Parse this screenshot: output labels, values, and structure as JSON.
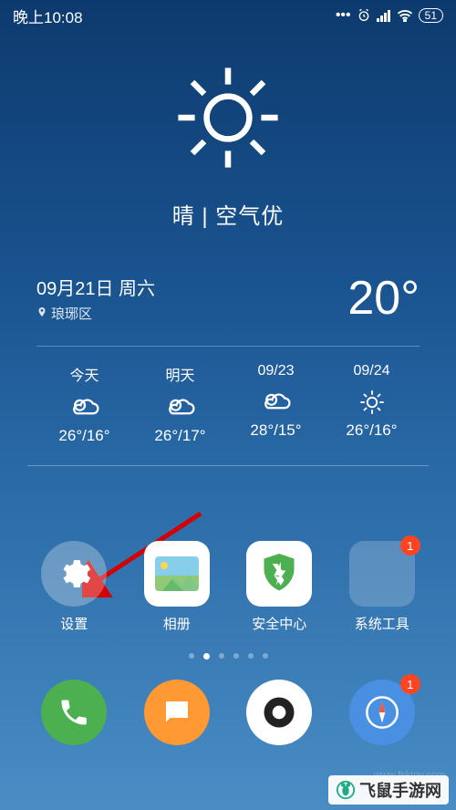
{
  "status": {
    "time": "晚上10:08",
    "battery": "51"
  },
  "weather": {
    "condition": "晴 | 空气优",
    "date": "09月21日 周六",
    "location": "琅琊区",
    "temp": "20°"
  },
  "forecast": [
    {
      "day": "今天",
      "icon": "cloudy",
      "temp": "26°/16°"
    },
    {
      "day": "明天",
      "icon": "cloudy",
      "temp": "26°/17°"
    },
    {
      "day": "09/23",
      "icon": "cloudy",
      "temp": "28°/15°"
    },
    {
      "day": "09/24",
      "icon": "sunny",
      "temp": "26°/16°"
    }
  ],
  "apps": {
    "settings": {
      "label": "设置"
    },
    "gallery": {
      "label": "相册"
    },
    "security": {
      "label": "安全中心"
    },
    "tools": {
      "label": "系统工具",
      "badge": "1"
    }
  },
  "dock": {
    "browser_badge": "1"
  },
  "watermark": {
    "text": "飞鼠手游网",
    "url": "www.fsktgy.com"
  },
  "colors": {
    "folder_minis": [
      "#ff7043",
      "#42a5f5",
      "#ffb74d",
      "#26a69a",
      "#9ccc65",
      "#ef5350",
      "#ab47bc",
      "#29b6f6",
      "#ffee58"
    ]
  }
}
